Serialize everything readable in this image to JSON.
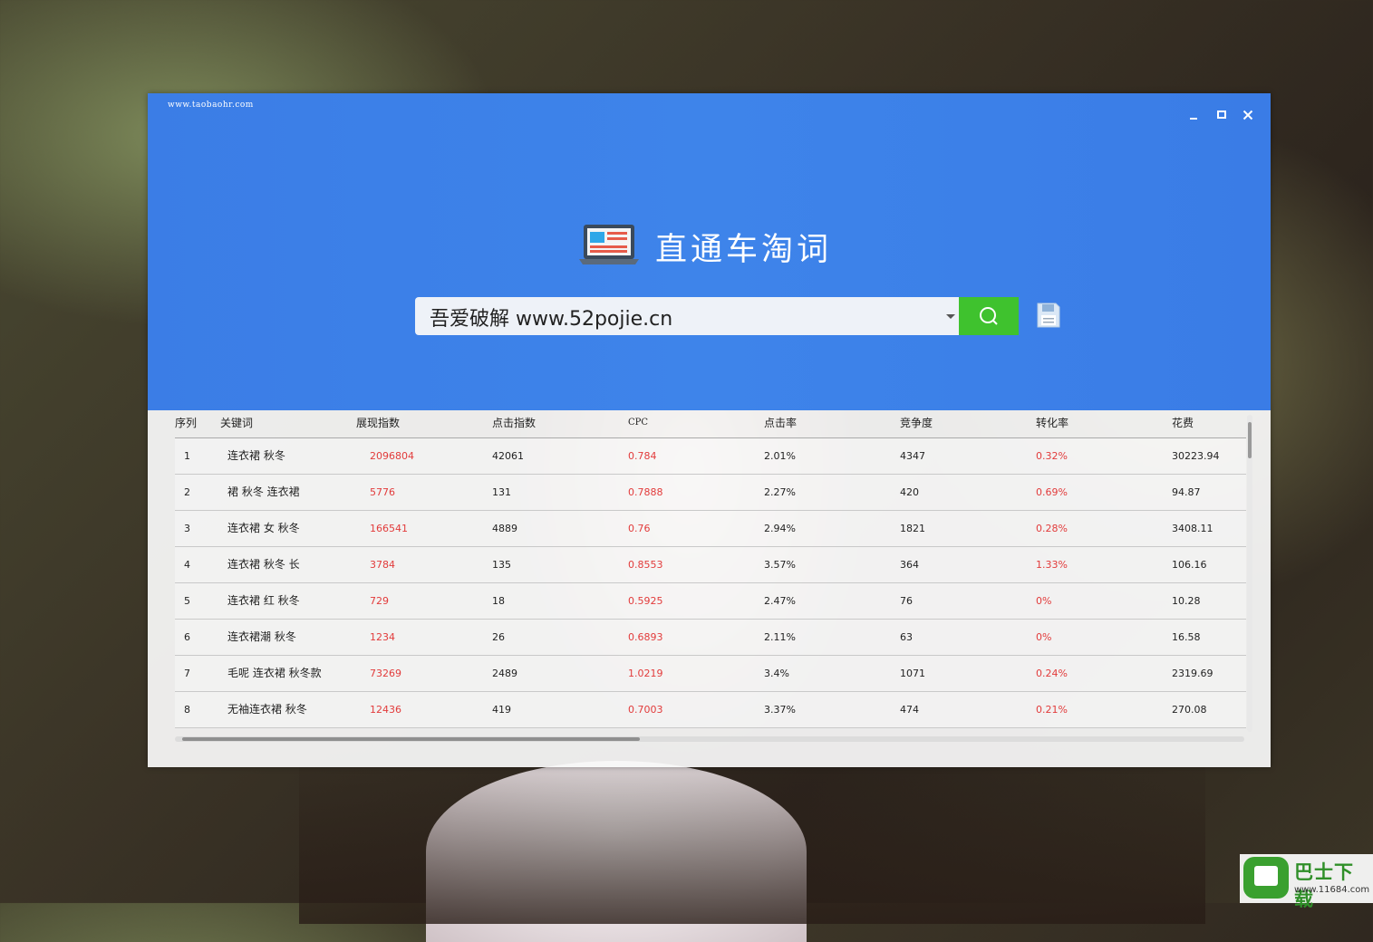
{
  "window": {
    "site": "www.taobaohr.com",
    "app_title": "直通车淘词"
  },
  "search": {
    "value": "吾爱破解 www.52pojie.cn"
  },
  "table": {
    "columns": [
      "序列",
      "关键词",
      "展现指数",
      "点击指数",
      "CPC",
      "点击率",
      "竞争度",
      "转化率",
      "花费"
    ],
    "rows": [
      {
        "seq": "1",
        "kw": "连衣裙 秋冬",
        "show": "2096804",
        "click": "42061",
        "cpc": "0.784",
        "ctr": "2.01%",
        "comp": "4347",
        "conv": "0.32%",
        "cost": "30223.94"
      },
      {
        "seq": "2",
        "kw": "裙 秋冬 连衣裙",
        "show": "5776",
        "click": "131",
        "cpc": "0.7888",
        "ctr": "2.27%",
        "comp": "420",
        "conv": "0.69%",
        "cost": "94.87"
      },
      {
        "seq": "3",
        "kw": "连衣裙 女 秋冬",
        "show": "166541",
        "click": "4889",
        "cpc": "0.76",
        "ctr": "2.94%",
        "comp": "1821",
        "conv": "0.28%",
        "cost": "3408.11"
      },
      {
        "seq": "4",
        "kw": "连衣裙 秋冬 长",
        "show": "3784",
        "click": "135",
        "cpc": "0.8553",
        "ctr": "3.57%",
        "comp": "364",
        "conv": "1.33%",
        "cost": "106.16"
      },
      {
        "seq": "5",
        "kw": "连衣裙 红 秋冬",
        "show": "729",
        "click": "18",
        "cpc": "0.5925",
        "ctr": "2.47%",
        "comp": "76",
        "conv": "0%",
        "cost": "10.28"
      },
      {
        "seq": "6",
        "kw": "连衣裙潮 秋冬",
        "show": "1234",
        "click": "26",
        "cpc": "0.6893",
        "ctr": "2.11%",
        "comp": "63",
        "conv": "0%",
        "cost": "16.58"
      },
      {
        "seq": "7",
        "kw": "毛呢 连衣裙 秋冬款",
        "show": "73269",
        "click": "2489",
        "cpc": "1.0219",
        "ctr": "3.4%",
        "comp": "1071",
        "conv": "0.24%",
        "cost": "2319.69"
      },
      {
        "seq": "8",
        "kw": "无袖连衣裙 秋冬",
        "show": "12436",
        "click": "419",
        "cpc": "0.7003",
        "ctr": "3.37%",
        "comp": "474",
        "conv": "0.21%",
        "cost": "270.08"
      }
    ]
  },
  "watermark": {
    "name": "巴士下载",
    "url": "www.11684.com"
  },
  "colors": {
    "header_blue": "#3b7de6",
    "search_green": "#3fc22e",
    "highlight_red": "#e23b3b"
  },
  "icons": [
    "minimize-icon",
    "maximize-icon",
    "close-icon",
    "laptop-logo-icon",
    "dropdown-caret-icon",
    "search-icon",
    "save-disk-icon"
  ]
}
